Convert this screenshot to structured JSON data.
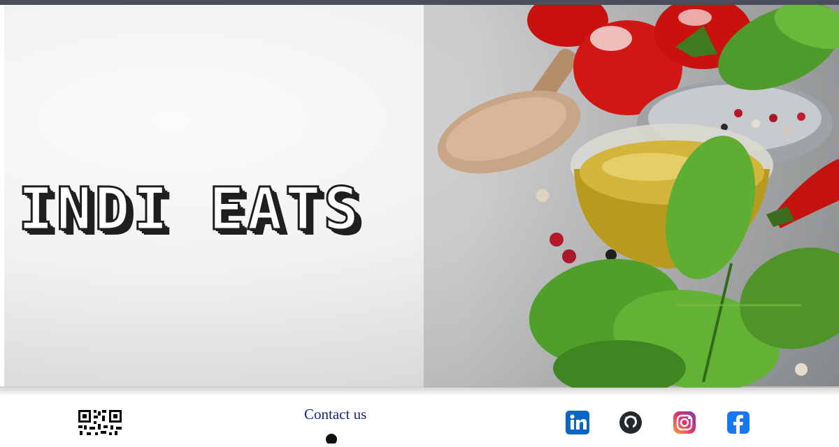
{
  "hero": {
    "title": "INDI EATS",
    "image": "food-ingredients-photo"
  },
  "footer": {
    "qr": "qr-code",
    "contact": {
      "title": "Contact us",
      "icon": "phone-icon"
    },
    "social": [
      {
        "name": "linkedin-icon",
        "label": "in",
        "color": "#0a66c2"
      },
      {
        "name": "github-icon",
        "color": "#24292e"
      },
      {
        "name": "instagram-icon",
        "color": "#e1306c"
      },
      {
        "name": "facebook-icon",
        "color": "#1877f2"
      }
    ]
  },
  "colors": {
    "topbar": "#4a4d5a",
    "contact_text": "#1a237e"
  }
}
